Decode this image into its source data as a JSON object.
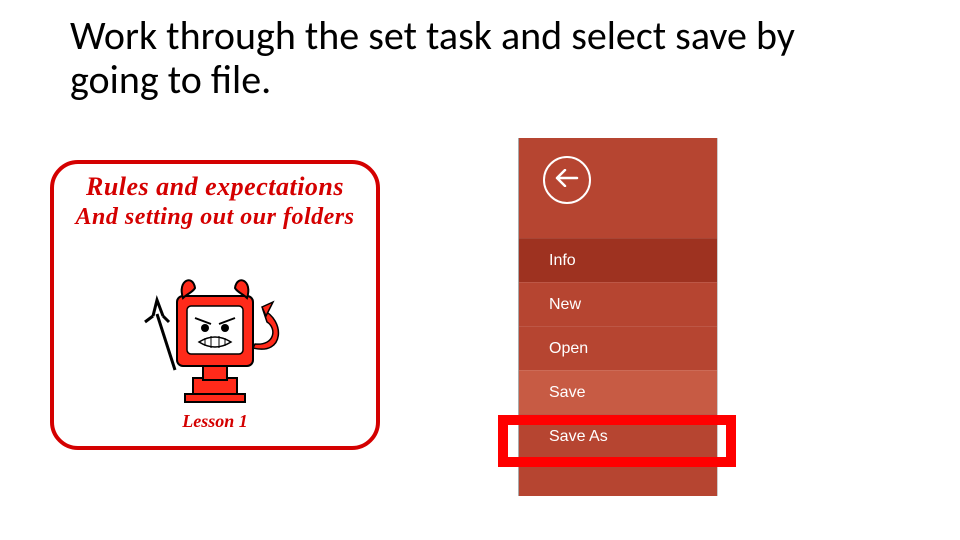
{
  "instruction": "Work through the set task and select save by going to file.",
  "card": {
    "title_line1": "Rules and expectations",
    "title_line2": "And setting out our folders",
    "lesson_label": "Lesson 1"
  },
  "filemenu": {
    "items": [
      {
        "label": "Info",
        "state": "selected"
      },
      {
        "label": "New",
        "state": "normal"
      },
      {
        "label": "Open",
        "state": "normal"
      },
      {
        "label": "Save",
        "state": "highlight"
      },
      {
        "label": "Save As",
        "state": "partial"
      }
    ]
  },
  "icons": {
    "back_arrow": "back-arrow-icon",
    "devil_computer": "devil-computer-icon"
  },
  "colors": {
    "accent_red": "#d40000",
    "menu_bg": "#b64531",
    "menu_sel": "#9e3220",
    "highlight": "#ff0000"
  }
}
